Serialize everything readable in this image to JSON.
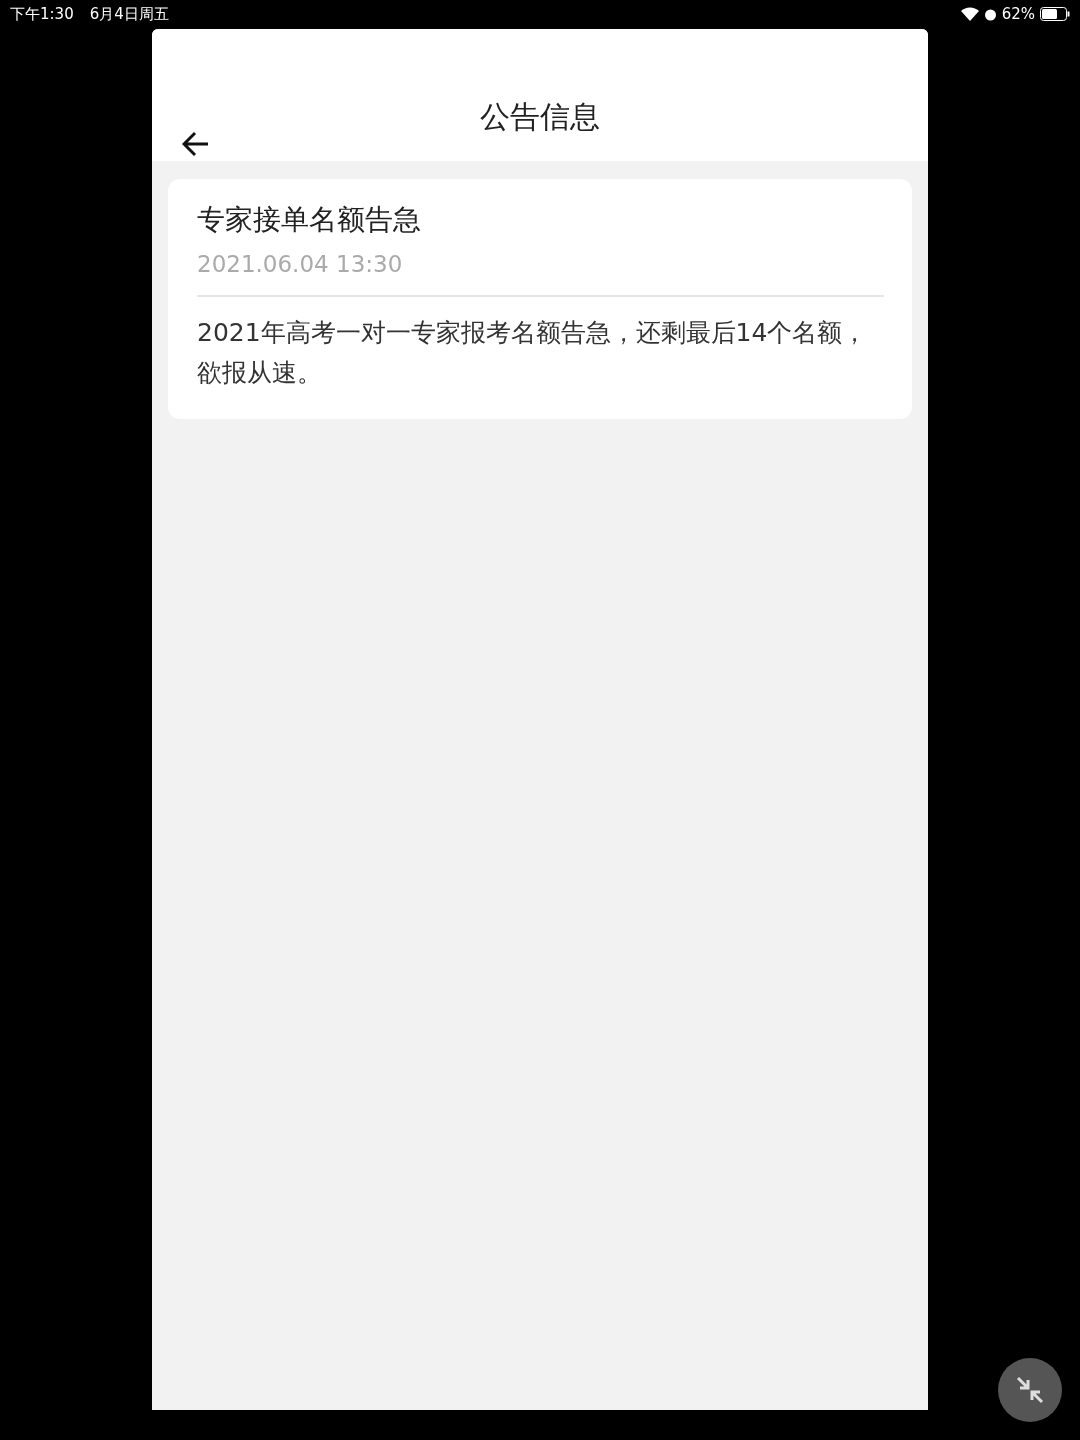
{
  "status_bar": {
    "time": "下午1:30",
    "date": "6月4日周五",
    "battery": "62%"
  },
  "header": {
    "title": "公告信息"
  },
  "notices": [
    {
      "title": "专家接单名额告急",
      "time": "2021.06.04 13:30",
      "body": "2021年高考一对一专家报考名额告急，还剩最后14个名额，欲报从速。"
    }
  ]
}
